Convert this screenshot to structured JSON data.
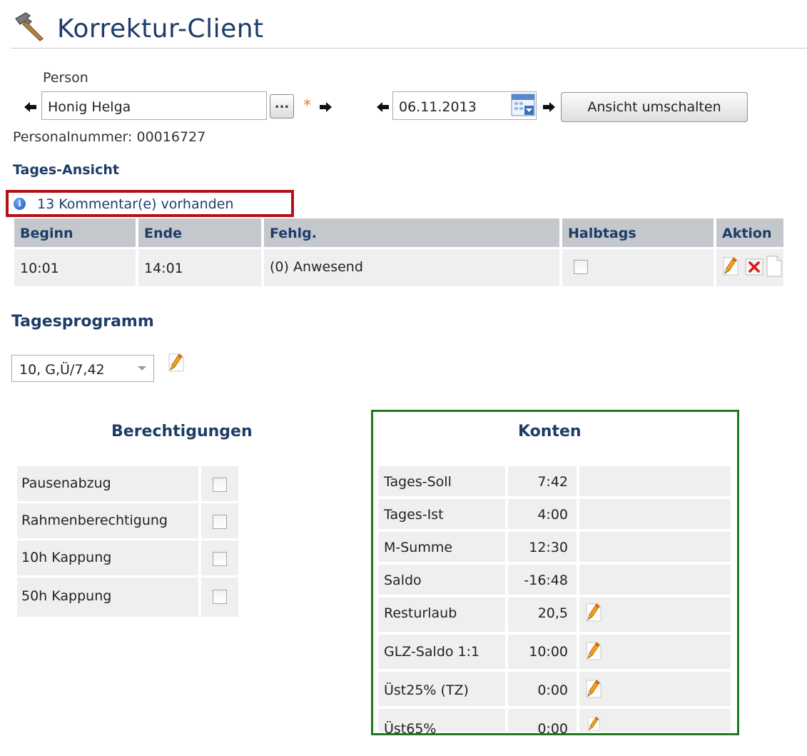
{
  "app": {
    "title": "Korrektur-Client"
  },
  "person": {
    "label": "Person",
    "name_value": "Honig Helga",
    "picker_label": "...",
    "required_marker": "*",
    "personnel_number_text": "Personalnummer: 00016727"
  },
  "date": {
    "value": "06.11.2013"
  },
  "toolbar": {
    "switch_view_label": "Ansicht umschalten"
  },
  "day_view": {
    "heading": "Tages-Ansicht",
    "comments_text": "13  Kommentar(e) vorhanden",
    "columns": [
      "Beginn",
      "Ende",
      "Fehlg.",
      "Halbtags",
      "Aktion"
    ],
    "rows": [
      {
        "begin": "10:01",
        "end": "14:01",
        "absence": "(0) Anwesend",
        "half_day": false
      }
    ]
  },
  "day_program": {
    "heading": "Tagesprogramm",
    "selected": "10, G,Ü/7,42"
  },
  "permissions": {
    "heading": "Berechtigungen",
    "items": [
      {
        "label": "Pausenabzug",
        "checked": false
      },
      {
        "label": "Rahmenberechtigung",
        "checked": false
      },
      {
        "label": "10h Kappung",
        "checked": false
      },
      {
        "label": "50h Kappung",
        "checked": false
      }
    ]
  },
  "accounts": {
    "heading": "Konten",
    "items": [
      {
        "label": "Tages-Soll",
        "value": "7:42",
        "editable": false
      },
      {
        "label": "Tages-Ist",
        "value": "4:00",
        "editable": false
      },
      {
        "label": "M-Summe",
        "value": "12:30",
        "editable": false
      },
      {
        "label": "Saldo",
        "value": "-16:48",
        "editable": false
      },
      {
        "label": "Resturlaub",
        "value": "20,5",
        "editable": true
      },
      {
        "label": "GLZ-Saldo 1:1",
        "value": "10:00",
        "editable": true
      },
      {
        "label": "Üst25% (TZ)",
        "value": "0:00",
        "editable": true
      },
      {
        "label": "Üst65%",
        "value": "0:00",
        "editable": true
      }
    ]
  },
  "colors": {
    "heading_blue": "#1d3c68",
    "comment_border_red": "#b41016",
    "accounts_border_green": "#1d7a1d",
    "table_header_gray": "#c4c7cb",
    "cell_gray": "#efefef",
    "required_orange": "#f07a1a"
  }
}
